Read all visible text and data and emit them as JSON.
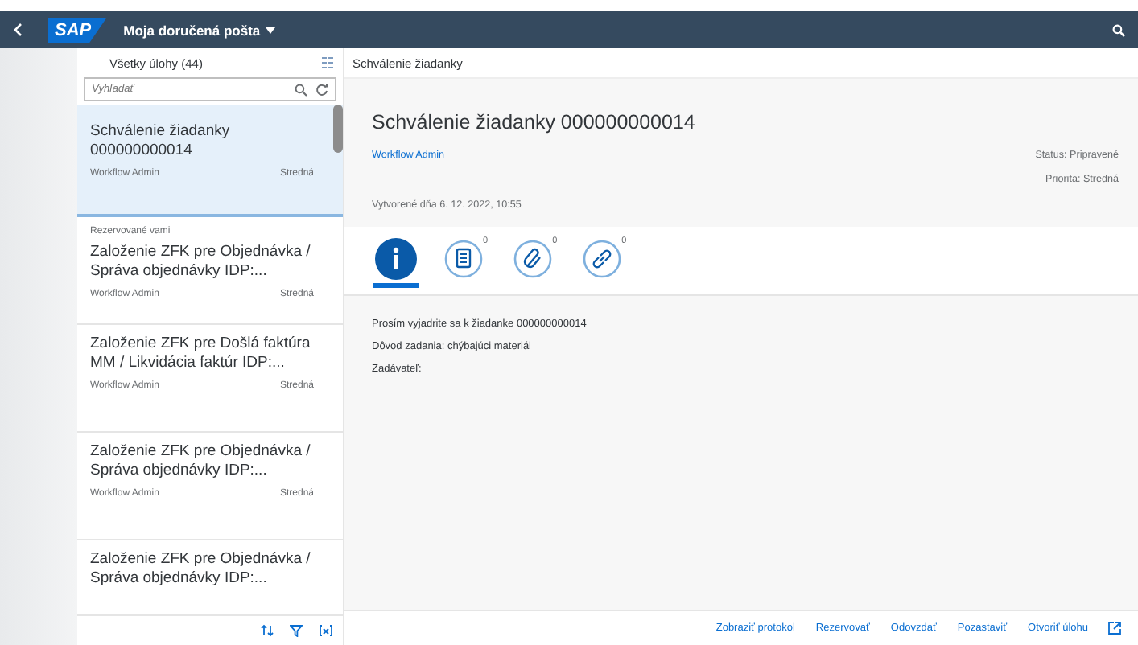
{
  "shell": {
    "logo": "SAP",
    "title": "Moja doručená pošta"
  },
  "master": {
    "title": "Všetky úlohy (44)",
    "search": {
      "placeholder": "Vyhľadať"
    },
    "items": [
      {
        "title": "Schválenie žiadanky 000000000014",
        "creator": "Workflow Admin",
        "priority": "Stredná",
        "selected": true
      },
      {
        "note": "Rezervované vami",
        "title": "Založenie ZFK pre Objednávka / Správa objednávky IDP:...",
        "creator": "Workflow Admin",
        "priority": "Stredná",
        "selected": false
      },
      {
        "title": "Založenie ZFK pre Došlá faktúra MM / Likvidácia faktúr IDP:...",
        "creator": "Workflow Admin",
        "priority": "Stredná",
        "selected": false
      },
      {
        "title": "Založenie ZFK pre Objednávka / Správa objednávky IDP:...",
        "creator": "Workflow Admin",
        "priority": "Stredná",
        "selected": false
      },
      {
        "title": "Založenie ZFK pre Objednávka / Správa objednávky IDP:...",
        "selected": false
      }
    ]
  },
  "detail": {
    "header": "Schválenie žiadanky",
    "title": "Schválenie žiadanky 000000000014",
    "creator": "Workflow Admin",
    "status": "Status: Pripravené",
    "priority": "Priorita: Stredná",
    "created": "Vytvorené dňa 6. 12. 2022, 10:55",
    "tabs": [
      {
        "kind": "info",
        "selected": true
      },
      {
        "kind": "notes",
        "count": "0",
        "selected": false
      },
      {
        "kind": "attachments",
        "count": "0",
        "selected": false
      },
      {
        "kind": "links",
        "count": "0",
        "selected": false
      }
    ],
    "lines": [
      "Prosím vyjadrite sa k žiadanke 000000000014",
      "Dôvod zadania: chýbajúci materiál",
      "Zadávateľ:"
    ],
    "actions": [
      "Zobraziť protokol",
      "Rezervovať",
      "Odovzdať",
      "Pozastaviť",
      "Otvoriť úlohu"
    ]
  }
}
